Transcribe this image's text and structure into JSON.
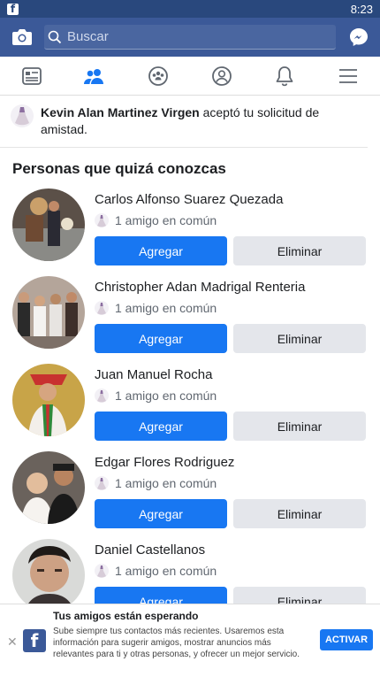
{
  "status": {
    "time": "8:23",
    "app_icon": "f"
  },
  "search": {
    "placeholder": "Buscar"
  },
  "nav": {
    "tabs": [
      "news-feed-icon",
      "friends-icon",
      "groups-icon",
      "profile-icon",
      "bell-icon",
      "menu-icon"
    ],
    "active": 1
  },
  "notification": {
    "name": "Kevin Alan Martinez Virgen",
    "text": " aceptó tu solicitud de amistad."
  },
  "section_title": "Personas que quizá conozcas",
  "people": [
    {
      "name": "Carlos Alfonso Suarez Quezada",
      "mutual": "1 amigo en común",
      "add": "Agregar",
      "delete": "Eliminar"
    },
    {
      "name": "Christopher Adan Madrigal Renteria",
      "mutual": "1 amigo en común",
      "add": "Agregar",
      "delete": "Eliminar"
    },
    {
      "name": "Juan Manuel Rocha",
      "mutual": "1 amigo en común",
      "add": "Agregar",
      "delete": "Eliminar"
    },
    {
      "name": "Edgar Flores Rodriguez",
      "mutual": "1 amigo en común",
      "add": "Agregar",
      "delete": "Eliminar"
    },
    {
      "name": "Daniel Castellanos",
      "mutual": "1 amigo en común",
      "add": "Agregar",
      "delete": "Eliminar"
    }
  ],
  "banner": {
    "title": "Tus amigos están esperando",
    "description": "Sube siempre tus contactos más recientes. Usaremos esta información para sugerir amigos, mostrar anuncios más relevantes para ti y otras personas, y ofrecer un mejor servicio.",
    "button": "ACTIVAR",
    "icon_letter": "f"
  },
  "colors": {
    "brand": "#3b5998",
    "status": "#29487d",
    "button": "#1877f2"
  }
}
